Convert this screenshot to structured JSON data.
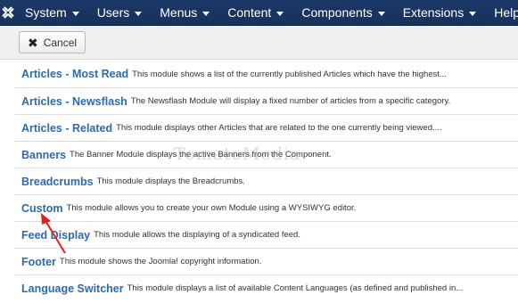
{
  "navbar": {
    "logo_icon": "joomla-logo-icon",
    "items": [
      {
        "label": "System"
      },
      {
        "label": "Users"
      },
      {
        "label": "Menus"
      },
      {
        "label": "Content"
      },
      {
        "label": "Components"
      },
      {
        "label": "Extensions"
      },
      {
        "label": "Help"
      }
    ]
  },
  "toolbar": {
    "cancel_label": "Cancel",
    "cancel_icon": "close-icon"
  },
  "modules": [
    {
      "title": "Articles - Most Read",
      "description": "This module shows a list of the currently published Articles which have the highest..."
    },
    {
      "title": "Articles - Newsflash",
      "description": "The Newsflash Module will display a fixed number of articles from a specific category."
    },
    {
      "title": "Articles - Related",
      "description": "This module displays other Articles that are related to the one currently being viewed...."
    },
    {
      "title": "Banners",
      "description": "The Banner Module displays the active Banners from the Component."
    },
    {
      "title": "Breadcrumbs",
      "description": "This module displays the Breadcrumbs."
    },
    {
      "title": "Custom",
      "description": "This module allows you to create your own Module using a WYSIWYG editor."
    },
    {
      "title": "Feed Display",
      "description": "This module allows the displaying of a syndicated feed."
    },
    {
      "title": "Footer",
      "description": "This module shows the Joomla! copyright information."
    },
    {
      "title": "Language Switcher",
      "description": "This module displays a list of available Content Languages (as defined and published in..."
    }
  ],
  "watermark": "TomatoMedia",
  "colors": {
    "navbar": "#1a3867",
    "link": "#2a6bb3",
    "annotation_arrow": "#e0201b"
  }
}
